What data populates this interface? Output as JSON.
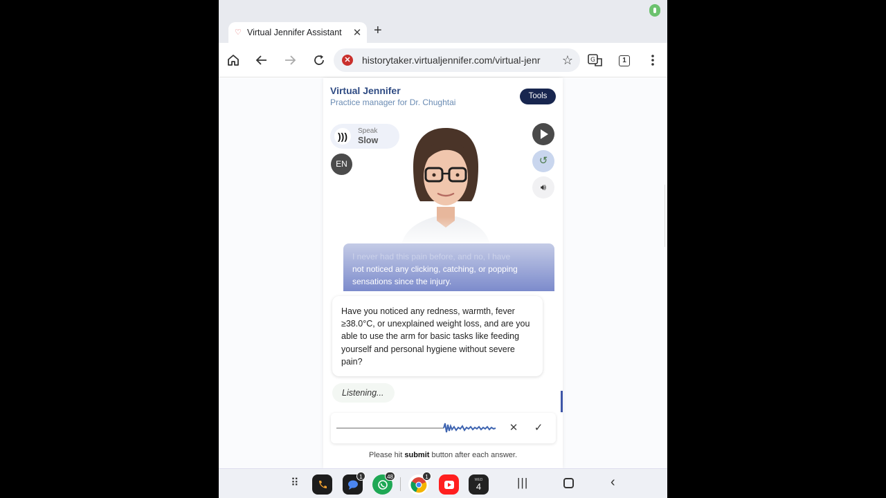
{
  "browser": {
    "tab_title": "Virtual Jennifer Assistant",
    "url": "historytaker.virtualjennifer.com/virtual-jenr",
    "tab_count": "1"
  },
  "app": {
    "title": "Virtual Jennifer",
    "subtitle": "Practice manager for Dr. Chughtai",
    "tools_label": "Tools",
    "speed_label": "Speak",
    "speed_value": "Slow",
    "language": "EN"
  },
  "chat": {
    "user_message_faded": "I never had this pain before, and no, I have",
    "user_message": "not noticed any clicking, catching, or popping sensations since the injury.",
    "bot_message": "Have you noticed any redness, warmth, fever ≥38.0°C, or unexplained weight loss, and are you able to use the arm for basic tasks like feeding yourself and personal hygiene without severe pain?",
    "status": "Listening..."
  },
  "footer": {
    "hint_before": "Please hit ",
    "hint_bold": "submit",
    "hint_after": " button after each answer."
  },
  "dock": {
    "messages_badge": "1",
    "whatsapp_badge": "48",
    "chrome_badge": "1",
    "calendar_label": "WED",
    "calendar_day": "4"
  },
  "colors": {
    "brand_navy": "#18264f",
    "title_blue": "#2f4b83",
    "user_bubble": "#7c8bcc"
  }
}
